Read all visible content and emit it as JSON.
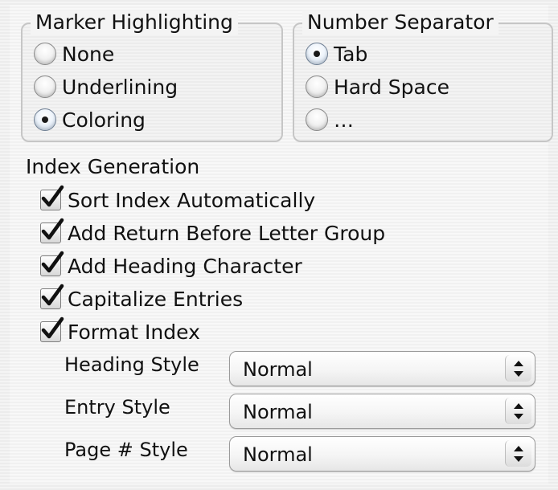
{
  "marker_highlighting": {
    "title": "Marker Highlighting",
    "options": [
      {
        "label": "None",
        "selected": false
      },
      {
        "label": "Underlining",
        "selected": false
      },
      {
        "label": "Coloring",
        "selected": true
      }
    ]
  },
  "number_separator": {
    "title": "Number Separator",
    "options": [
      {
        "label": "Tab",
        "selected": true
      },
      {
        "label": "Hard Space",
        "selected": false
      },
      {
        "label": "…",
        "selected": false
      }
    ]
  },
  "index_generation": {
    "title": "Index Generation",
    "checkboxes": [
      {
        "label": "Sort Index Automatically",
        "checked": true
      },
      {
        "label": "Add Return Before Letter Group",
        "checked": true
      },
      {
        "label": "Add Heading Character",
        "checked": true
      },
      {
        "label": "Capitalize Entries",
        "checked": true
      },
      {
        "label": "Format Index",
        "checked": true
      }
    ],
    "styles": [
      {
        "label": "Heading Style",
        "value": "Normal"
      },
      {
        "label": "Entry Style",
        "value": "Normal"
      },
      {
        "label": "Page # Style",
        "value": "Normal"
      }
    ]
  },
  "icons": {
    "radio_selected": "radio-dot",
    "checkbox_checked": "checkmark",
    "popup_arrows": "up-down-arrows-icon"
  },
  "colors": {
    "group_border": "#c6c6c6",
    "text": "#111111"
  }
}
